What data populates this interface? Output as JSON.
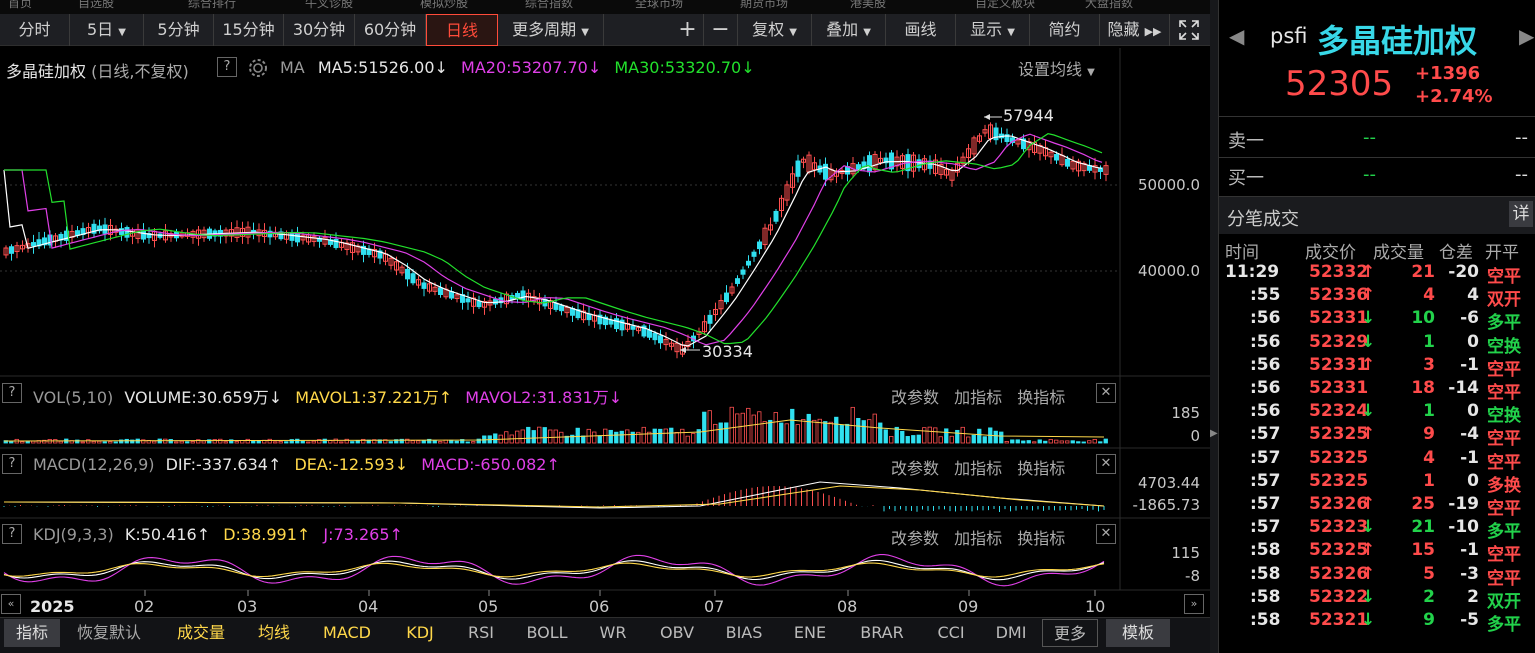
{
  "menu": [
    "首页",
    "自选股",
    "综合排行",
    "牛叉诊股",
    "模拟炒股",
    "综合指数",
    "全球市场",
    "期货市场",
    "港美股",
    "自定义板块",
    "大盘指数"
  ],
  "toolbar": {
    "fenshi": "分时",
    "day5": "5日",
    "m5": "5分钟",
    "m15": "15分钟",
    "m30": "30分钟",
    "m60": "60分钟",
    "daily": "日线",
    "more": "更多周期",
    "plus": "+",
    "minus": "−",
    "fuquan": "复权",
    "diejia": "叠加",
    "huaxian": "画线",
    "xianshi": "显示",
    "jianyue": "简约",
    "yincang": "隐藏"
  },
  "main": {
    "name": "多晶硅加权",
    "mode": "(日线,不复权)",
    "q": "?",
    "ma": "MA",
    "ma5": "MA5:51526.00",
    "ma20": "MA20:53207.70",
    "ma30": "MA30:53320.70",
    "setting": "设置均线",
    "high": "57944",
    "low": "30334",
    "ax1": "50000.0",
    "ax2": "40000.0"
  },
  "vol": {
    "q": "?",
    "name": "VOL(5,10)",
    "volume": "VOLUME:30.659万",
    "mavol1": "MAVOL1:37.221万",
    "mavol2": "MAVOL2:31.831万",
    "ax1": "185",
    "ax2": "0"
  },
  "macd": {
    "q": "?",
    "name": "MACD(12,26,9)",
    "dif": "DIF:-337.634",
    "dea": "DEA:-12.593",
    "macd": "MACD:-650.082",
    "ax1": "4703.44",
    "ax2": "-1865.73"
  },
  "kdj": {
    "q": "?",
    "name": "KDJ(9,3,3)",
    "k": "K:50.416",
    "d": "D:38.991",
    "j": "J:73.265",
    "ax1": "115",
    "ax2": "-8"
  },
  "panel": {
    "gaicanshu": "改参数",
    "jiazhibiao": "加指标",
    "huanzhibiao": "换指标",
    "close": "✕"
  },
  "xaxis": {
    "year": "2025",
    "months": [
      "02",
      "03",
      "04",
      "05",
      "06",
      "07",
      "08",
      "09",
      "10"
    ]
  },
  "bottom": [
    "指标",
    "恢复默认",
    "成交量",
    "均线",
    "MACD",
    "KDJ",
    "RSI",
    "BOLL",
    "WR",
    "OBV",
    "BIAS",
    "ENE",
    "BRAR",
    "CCI",
    "DMI",
    "更多",
    "模板"
  ],
  "quote": {
    "code": "psfi",
    "name": "多晶硅加权",
    "price": "52305",
    "change": "+1396",
    "pct": "+2.74%",
    "sell1": "卖一",
    "buy1": "买一",
    "dash": "--",
    "ticks_title": "分笔成交",
    "detail": "详",
    "headers": [
      "时间",
      "成交价",
      "成交量",
      "仓差",
      "开平"
    ],
    "ticks": [
      {
        "t": "11:29",
        "p": "52332",
        "a": "↑",
        "v": "21",
        "d": "-20",
        "o": "空平",
        "pc": "red",
        "vc": "red",
        "oc": "red"
      },
      {
        "t": ":55",
        "p": "52336",
        "a": "↑",
        "v": "4",
        "d": "4",
        "o": "双开",
        "pc": "red",
        "vc": "red",
        "oc": "red"
      },
      {
        "t": ":56",
        "p": "52331",
        "a": "↓",
        "v": "10",
        "d": "-6",
        "o": "多平",
        "pc": "red",
        "vc": "grn",
        "oc": "grn"
      },
      {
        "t": ":56",
        "p": "52329",
        "a": "↓",
        "v": "1",
        "d": "0",
        "o": "空换",
        "pc": "red",
        "vc": "grn",
        "oc": "grn"
      },
      {
        "t": ":56",
        "p": "52331",
        "a": "↑",
        "v": "3",
        "d": "-1",
        "o": "空平",
        "pc": "red",
        "vc": "red",
        "oc": "red"
      },
      {
        "t": ":56",
        "p": "52331",
        "a": "",
        "v": "18",
        "d": "-14",
        "o": "空平",
        "pc": "red",
        "vc": "red",
        "oc": "red"
      },
      {
        "t": ":56",
        "p": "52324",
        "a": "↓",
        "v": "1",
        "d": "0",
        "o": "空换",
        "pc": "red",
        "vc": "grn",
        "oc": "grn"
      },
      {
        "t": ":57",
        "p": "52325",
        "a": "↑",
        "v": "9",
        "d": "-4",
        "o": "空平",
        "pc": "red",
        "vc": "red",
        "oc": "red"
      },
      {
        "t": ":57",
        "p": "52325",
        "a": "",
        "v": "4",
        "d": "-1",
        "o": "空平",
        "pc": "red",
        "vc": "red",
        "oc": "red"
      },
      {
        "t": ":57",
        "p": "52325",
        "a": "",
        "v": "1",
        "d": "0",
        "o": "多换",
        "pc": "red",
        "vc": "red",
        "oc": "red"
      },
      {
        "t": ":57",
        "p": "52326",
        "a": "↑",
        "v": "25",
        "d": "-19",
        "o": "空平",
        "pc": "red",
        "vc": "red",
        "oc": "red"
      },
      {
        "t": ":57",
        "p": "52323",
        "a": "↓",
        "v": "21",
        "d": "-10",
        "o": "多平",
        "pc": "red",
        "vc": "grn",
        "oc": "grn"
      },
      {
        "t": ":58",
        "p": "52325",
        "a": "↑",
        "v": "15",
        "d": "-1",
        "o": "空平",
        "pc": "red",
        "vc": "red",
        "oc": "red"
      },
      {
        "t": ":58",
        "p": "52326",
        "a": "↑",
        "v": "5",
        "d": "-3",
        "o": "空平",
        "pc": "red",
        "vc": "red",
        "oc": "red"
      },
      {
        "t": ":58",
        "p": "52322",
        "a": "↓",
        "v": "2",
        "d": "2",
        "o": "双开",
        "pc": "red",
        "vc": "grn",
        "oc": "grn"
      },
      {
        "t": ":58",
        "p": "52321",
        "a": "↓",
        "v": "9",
        "d": "-5",
        "o": "多平",
        "pc": "red",
        "vc": "grn",
        "oc": "grn"
      }
    ]
  }
}
